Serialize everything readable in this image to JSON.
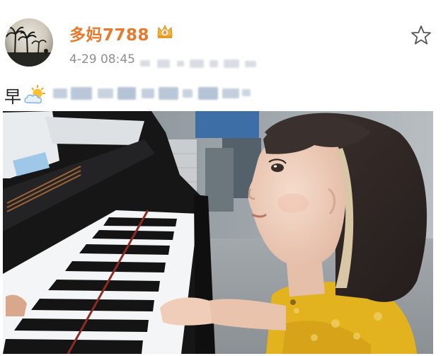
{
  "author": {
    "name": "多妈7788",
    "badge_icon": "crown-vip-icon"
  },
  "post": {
    "timestamp": "4-29 08:45",
    "text": "早",
    "weather_icon": "sun-cloud-icon"
  },
  "actions": {
    "favorite_icon": "star-icon"
  },
  "colors": {
    "author_name": "#e8792b",
    "meta_text": "#8f8f8f"
  }
}
